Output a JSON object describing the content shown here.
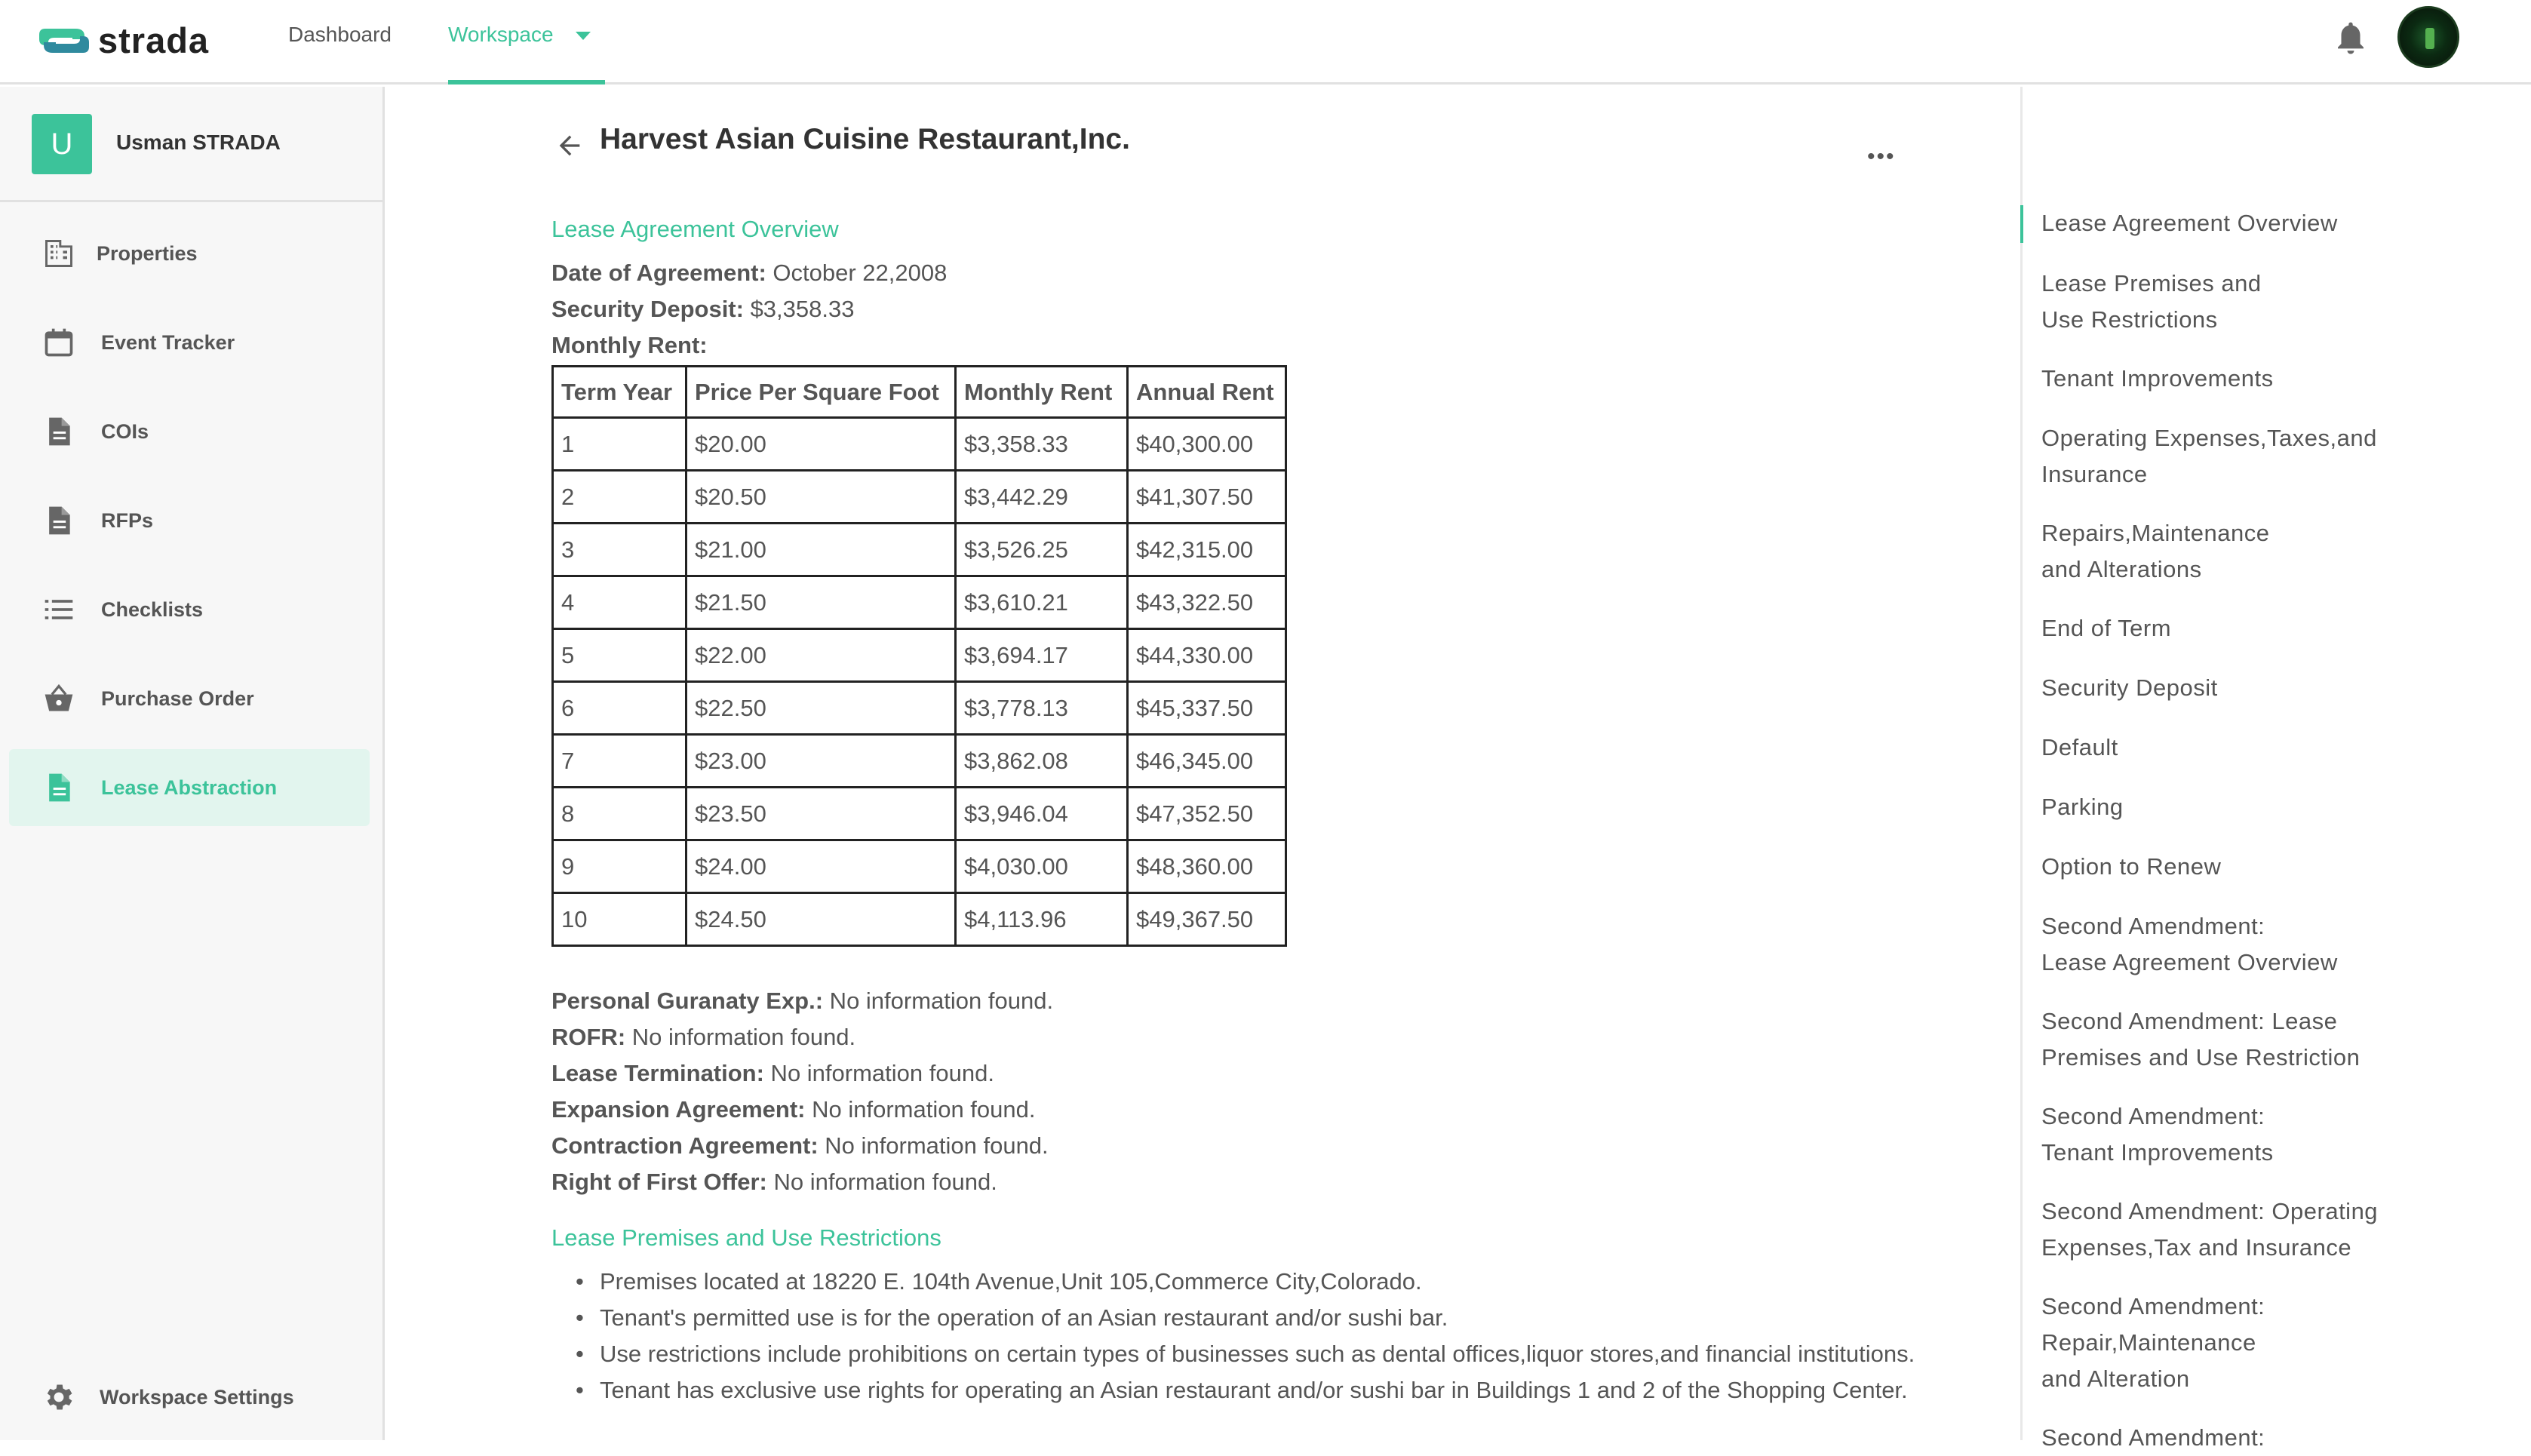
{
  "brand": {
    "name": "strada",
    "accent": "#3cc39a"
  },
  "topnav": {
    "items": [
      {
        "label": "Dashboard"
      },
      {
        "label": "Workspace"
      }
    ]
  },
  "sidebar": {
    "user": {
      "initial": "U",
      "name": "Usman STRADA"
    },
    "items": [
      {
        "label": "Properties",
        "icon": "building-icon"
      },
      {
        "label": "Event Tracker",
        "icon": "calendar-icon"
      },
      {
        "label": "COIs",
        "icon": "document-icon"
      },
      {
        "label": "RFPs",
        "icon": "document-icon"
      },
      {
        "label": "Checklists",
        "icon": "list-icon"
      },
      {
        "label": "Purchase Order",
        "icon": "basket-icon"
      },
      {
        "label": "Lease Abstraction",
        "icon": "document-icon",
        "active": true
      }
    ],
    "footer": {
      "label": "Workspace Settings",
      "icon": "gear-icon"
    }
  },
  "document": {
    "title": "Harvest Asian Cuisine Restaurant,Inc.",
    "more": "•••",
    "overview": {
      "heading": "Lease Agreement Overview",
      "date_label": "Date of Agreement:",
      "date_value": " October 22,2008",
      "deposit_label": "Security Deposit:",
      "deposit_value": " $3,358.33",
      "rent_label": "Monthly Rent:"
    },
    "rent_table": {
      "headers": [
        "Term Year",
        "Price Per Square Foot",
        "Monthly Rent",
        "Annual Rent"
      ],
      "rows": [
        [
          "1",
          "$20.00",
          "$3,358.33",
          "$40,300.00"
        ],
        [
          "2",
          "$20.50",
          "$3,442.29",
          "$41,307.50"
        ],
        [
          "3",
          "$21.00",
          "$3,526.25",
          "$42,315.00"
        ],
        [
          "4",
          "$21.50",
          "$3,610.21",
          "$43,322.50"
        ],
        [
          "5",
          "$22.00",
          "$3,694.17",
          "$44,330.00"
        ],
        [
          "6",
          "$22.50",
          "$3,778.13",
          "$45,337.50"
        ],
        [
          "7",
          "$23.00",
          "$3,862.08",
          "$46,345.00"
        ],
        [
          "8",
          "$23.50",
          "$3,946.04",
          "$47,352.50"
        ],
        [
          "9",
          "$24.00",
          "$4,030.00",
          "$48,360.00"
        ],
        [
          "10",
          "$24.50",
          "$4,113.96",
          "$49,367.50"
        ]
      ]
    },
    "fields": [
      {
        "label": "Personal Guranaty Exp.:",
        "value": " No information found."
      },
      {
        "label": "ROFR:",
        "value": " No information found."
      },
      {
        "label": "Lease Termination:",
        "value": " No information found."
      },
      {
        "label": "Expansion Agreement:",
        "value": " No information found."
      },
      {
        "label": "Contraction Agreement:",
        "value": " No information found."
      },
      {
        "label": "Right of First Offer:",
        "value": " No information found."
      }
    ],
    "premises": {
      "heading": "Lease Premises and Use Restrictions",
      "bullets": [
        "Premises located at 18220 E. 104th Avenue,Unit 105,Commerce City,Colorado.",
        "Tenant's permitted use is for the operation of an Asian restaurant and/or sushi bar.",
        "Use restrictions include prohibitions on certain types of businesses such as dental offices,liquor stores,and financial institutions.",
        "Tenant has exclusive use rights for operating an Asian restaurant and/or sushi bar in Buildings 1 and 2 of the Shopping Center."
      ]
    }
  },
  "toc": {
    "items": [
      "Lease Agreement Overview",
      "Lease Premises and\nUse Restrictions",
      "Tenant Improvements",
      "Operating Expenses,Taxes,and\nInsurance",
      "Repairs,Maintenance\nand Alterations",
      "End of Term",
      "Security Deposit",
      "Default",
      "Parking",
      "Option to Renew",
      "Second Amendment:\nLease Agreement Overview",
      "Second Amendment: Lease\nPremises and Use Restriction",
      "Second Amendment:\nTenant Improvements",
      "Second Amendment: Operating\nExpenses,Tax and Insurance",
      "Second Amendment:\nRepair,Maintenance\nand Alteration",
      "Second Amendment:"
    ]
  }
}
